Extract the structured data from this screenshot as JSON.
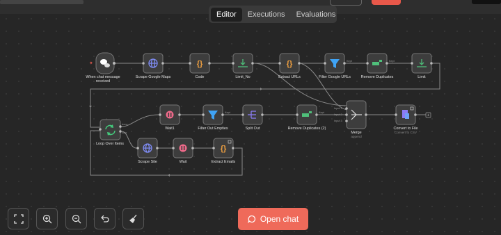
{
  "tabs": [
    {
      "label": "Editor",
      "active": true
    },
    {
      "label": "Executions",
      "active": false
    },
    {
      "label": "Evaluations",
      "active": false
    }
  ],
  "nodes": {
    "chat_trigger": {
      "label_line1": "When chat message",
      "label_line2": "received"
    },
    "scrape_google_maps": {
      "label": "Scrape Google Maps"
    },
    "code": {
      "label": "Code"
    },
    "limit_no": {
      "label": "Limit_No"
    },
    "extract_urls": {
      "label": "Extract URLs"
    },
    "filter_google_urls": {
      "label": "Filter Google URLs"
    },
    "remove_duplicates": {
      "label": "Remove Duplicates"
    },
    "limit": {
      "label": "Limit"
    },
    "loop_over_items": {
      "label": "Loop Over Items",
      "port_done": "done",
      "port_loop": "loop"
    },
    "wait1": {
      "label": "Wait1"
    },
    "filter_out_empties": {
      "label": "Filter Out Empties"
    },
    "split_out": {
      "label": "Split Out"
    },
    "remove_duplicates_2": {
      "label": "Remove Duplicates (2)"
    },
    "merge": {
      "label": "Merge",
      "sublabel": "append",
      "input1": "Input 1",
      "input2": "Input 2",
      "input3": "Input 3"
    },
    "convert_to_file": {
      "label": "Convert to File",
      "sublabel": "Convert to CSV"
    },
    "scrape_site": {
      "label": "Scrape Site"
    },
    "wait": {
      "label": "Wait"
    },
    "extract_emails": {
      "label": "Extract Emails"
    }
  },
  "controls": {
    "open_chat_label": "Open chat"
  },
  "colors": {
    "accent": "#ef6a5a",
    "canvas": "#262626",
    "node_bg": "#3d3d3d",
    "connection": "#8a8a8a",
    "globe": "#7f8cf5",
    "code_braces": "#f0a040",
    "limit_green": "#4fbf7a",
    "filter_blue": "#3fa3f5",
    "wait_pink": "#ef6a8a",
    "split_purple": "#8b7cf5",
    "loop_green": "#44c97c"
  }
}
